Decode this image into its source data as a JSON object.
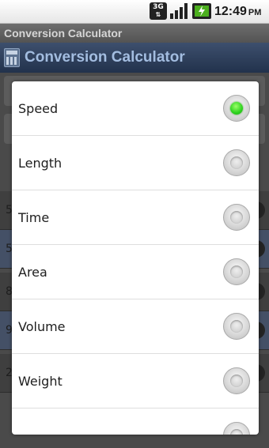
{
  "status_bar": {
    "network": "3G",
    "time": "12:49",
    "ampm": "PM"
  },
  "window_title": "Conversion Calculator",
  "app_header": {
    "title": "Conversion Calculator"
  },
  "background_values": [
    "5",
    "5",
    "8",
    "9",
    "2"
  ],
  "dialog": {
    "options": [
      {
        "label": "Speed",
        "selected": true
      },
      {
        "label": "Length",
        "selected": false
      },
      {
        "label": "Time",
        "selected": false
      },
      {
        "label": "Area",
        "selected": false
      },
      {
        "label": "Volume",
        "selected": false
      },
      {
        "label": "Weight",
        "selected": false
      }
    ]
  },
  "colors": {
    "selected_radio": "#2dd21e",
    "header_text": "#a3bde0"
  }
}
